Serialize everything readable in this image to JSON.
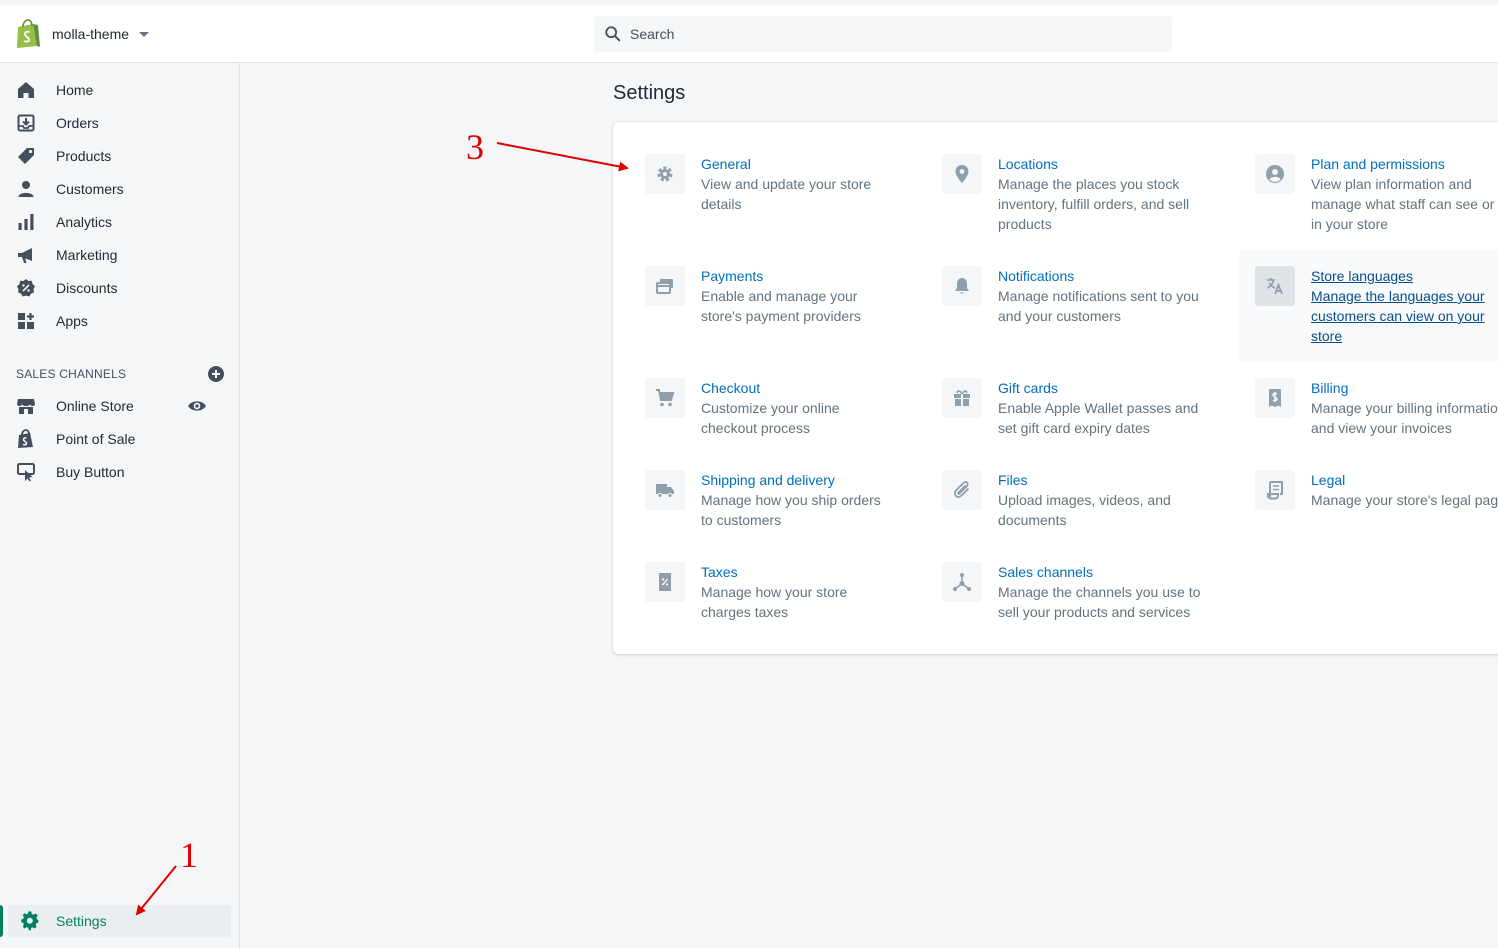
{
  "store": {
    "name": "molla-theme"
  },
  "search": {
    "placeholder": "Search"
  },
  "sidebar": {
    "items": [
      {
        "label": "Home"
      },
      {
        "label": "Orders"
      },
      {
        "label": "Products"
      },
      {
        "label": "Customers"
      },
      {
        "label": "Analytics"
      },
      {
        "label": "Marketing"
      },
      {
        "label": "Discounts"
      },
      {
        "label": "Apps"
      }
    ],
    "sales_channels_title": "SALES CHANNELS",
    "channels": [
      {
        "label": "Online Store"
      },
      {
        "label": "Point of Sale"
      },
      {
        "label": "Buy Button"
      }
    ],
    "settings_label": "Settings"
  },
  "main": {
    "title": "Settings",
    "tiles": [
      {
        "icon": "gear-icon",
        "title": "General",
        "desc1": "View and update your store",
        "desc2": "details",
        "desc3": ""
      },
      {
        "icon": "location-pin-icon",
        "title": "Locations",
        "desc1": "Manage the places you stock",
        "desc2": "inventory, fulfill orders, and sell",
        "desc3": "products"
      },
      {
        "icon": "user-circle-icon",
        "title": "Plan and permissions",
        "desc1": "View plan information and",
        "desc2": "manage what staff can see or do",
        "desc3": "in your store"
      },
      {
        "icon": "payment-icon",
        "title": "Payments",
        "desc1": "Enable and manage your",
        "desc2": "store's payment providers",
        "desc3": ""
      },
      {
        "icon": "bell-icon",
        "title": "Notifications",
        "desc1": "Manage notifications sent to you",
        "desc2": "and your customers",
        "desc3": ""
      },
      {
        "icon": "translate-icon",
        "title": "Store languages",
        "desc1": "Manage the languages your",
        "desc2": "customers can view on your",
        "desc3": "store"
      },
      {
        "icon": "cart-icon",
        "title": "Checkout",
        "desc1": "Customize your online",
        "desc2": "checkout process",
        "desc3": ""
      },
      {
        "icon": "gift-icon",
        "title": "Gift cards",
        "desc1": "Enable Apple Wallet passes and",
        "desc2": "set gift card expiry dates",
        "desc3": ""
      },
      {
        "icon": "billing-icon",
        "title": "Billing",
        "desc1": "Manage your billing information",
        "desc2": "and view your invoices",
        "desc3": ""
      },
      {
        "icon": "truck-icon",
        "title": "Shipping and delivery",
        "desc1": "Manage how you ship orders",
        "desc2": "to customers",
        "desc3": ""
      },
      {
        "icon": "paperclip-icon",
        "title": "Files",
        "desc1": "Upload images, videos, and",
        "desc2": "documents",
        "desc3": ""
      },
      {
        "icon": "legal-icon",
        "title": "Legal",
        "desc1": "Manage your store's legal pages",
        "desc2": "",
        "desc3": ""
      },
      {
        "icon": "tax-icon",
        "title": "Taxes",
        "desc1": "Manage how your store",
        "desc2": "charges taxes",
        "desc3": ""
      },
      {
        "icon": "sales-channels-icon",
        "title": "Sales channels",
        "desc1": "Manage the channels you use to",
        "desc2": "sell your products and services",
        "desc3": ""
      }
    ]
  },
  "annotations": {
    "one": "1",
    "three": "3"
  },
  "colors": {
    "accent": "#008060",
    "link": "#006fbb",
    "annotation": "#e00000",
    "icon": "#919eab"
  }
}
